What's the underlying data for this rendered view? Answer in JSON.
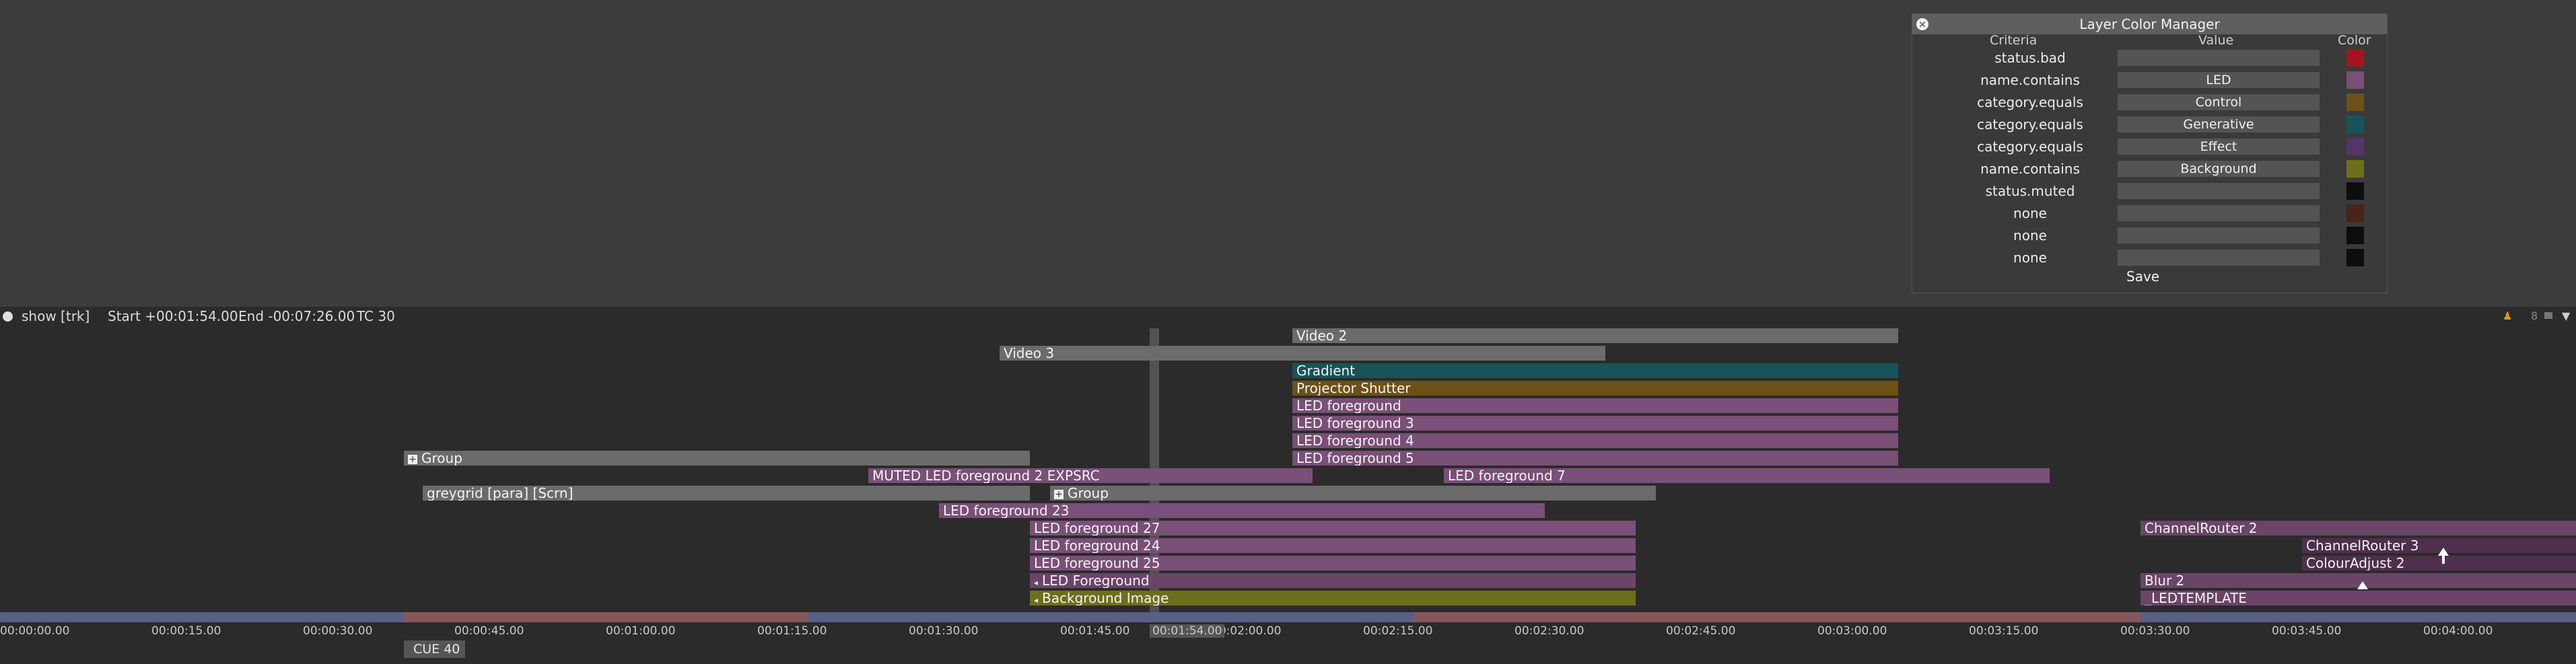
{
  "panel": {
    "title": "Layer Color Manager",
    "headers": {
      "criteria": "Criteria",
      "value": "Value",
      "color": "Color"
    },
    "rows": [
      {
        "criteria": "status.bad",
        "value": "",
        "color": "#a4141c"
      },
      {
        "criteria": "name.contains",
        "value": "LED",
        "color": "#7a4f78"
      },
      {
        "criteria": "category.equals",
        "value": "Control",
        "color": "#6e5117"
      },
      {
        "criteria": "category.equals",
        "value": "Generative",
        "color": "#17545a"
      },
      {
        "criteria": "category.equals",
        "value": "Effect",
        "color": "#533566"
      },
      {
        "criteria": "name.contains",
        "value": "Background",
        "color": "#6e6f1a"
      },
      {
        "criteria": "status.muted",
        "value": "",
        "color": "#0d0d0d"
      },
      {
        "criteria": "none",
        "value": "",
        "color": "#4a2417"
      },
      {
        "criteria": "none",
        "value": "",
        "color": "#0d0d0d"
      },
      {
        "criteria": "none",
        "value": "",
        "color": "#0d0d0d"
      }
    ],
    "save_label": "Save"
  },
  "status": {
    "show": "show [trk]",
    "start": "Start +00:01:54.00",
    "end": "End -00:07:26.00",
    "tc": "TC 30",
    "right_num": "8"
  },
  "layers": {
    "video2": "Video 2",
    "video3": "Video 3",
    "gradient": "Gradient",
    "projector_shutter": "Projector Shutter",
    "led_fg": "LED foreground",
    "led_fg3": "LED foreground 3",
    "led_fg4": "LED foreground 4",
    "led_fg5": "LED foreground 5",
    "group1": "Group",
    "muted_led": "MUTED LED foreground 2 EXPSRC",
    "led_fg7": "LED foreground 7",
    "greygrid": "greygrid [para] [Scrn]",
    "group2": "Group",
    "led_fg23": "LED foreground 23",
    "led_fg27": "LED foreground 27",
    "led_fg24": "LED foreground 24",
    "led_fg25": "LED foreground 25",
    "led_foreground_cap": "LED Foreground",
    "background_image": "Background Image",
    "channelrouter2": "ChannelRouter 2",
    "channelrouter3": "ChannelRouter 3",
    "colouradjust2": "ColourAdjust 2",
    "blur2": "Blur 2",
    "ledtemplate": "_LEDTEMPLATE"
  },
  "ruler": {
    "labels": [
      "00:00:00.00",
      "00:00:15.00",
      "00:00:30.00",
      "00:00:45.00",
      "00:01:00.00",
      "00:01:15.00",
      "00:01:30.00",
      "00:01:45.00",
      "00:02:00.00",
      "00:02:15.00",
      "00:02:30.00",
      "00:02:45.00",
      "00:03:00.00",
      "00:03:15.00",
      "00:03:30.00",
      "00:03:45.00",
      "00:04:00.00"
    ],
    "playhead": "00:01:54.00",
    "cue": "CUE 40"
  }
}
